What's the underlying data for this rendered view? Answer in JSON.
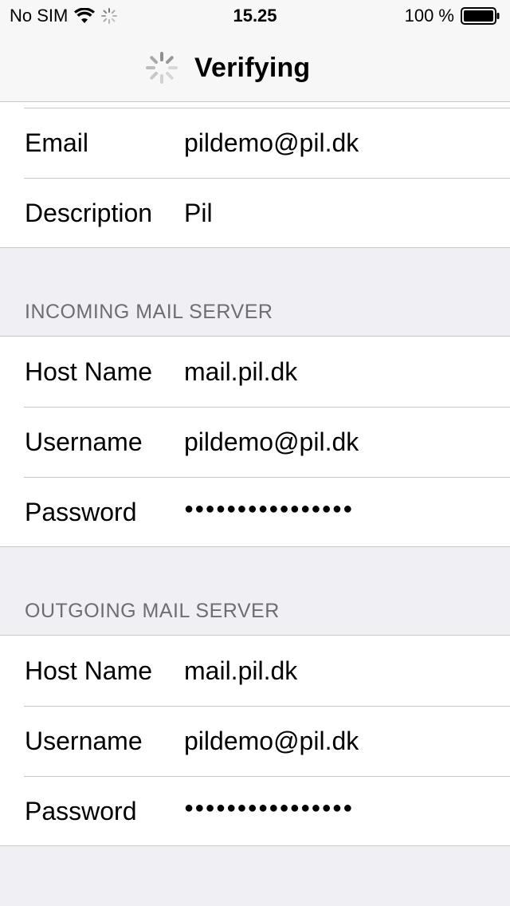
{
  "status_bar": {
    "carrier": "No SIM",
    "time": "15.25",
    "battery_percent": "100 %",
    "icons": [
      "wifi-icon",
      "activity-icon",
      "battery-icon"
    ]
  },
  "nav": {
    "title": "Verifying",
    "spinner_icon": "spinner-icon"
  },
  "account": {
    "rows": [
      {
        "label": "Email",
        "value": "pildemo@pil.dk"
      },
      {
        "label": "Description",
        "value": "Pil"
      }
    ]
  },
  "incoming": {
    "header": "INCOMING MAIL SERVER",
    "rows": [
      {
        "label": "Host Name",
        "value": "mail.pil.dk"
      },
      {
        "label": "Username",
        "value": "pildemo@pil.dk"
      },
      {
        "label": "Password",
        "value": "●●●●●●●●●●●●●●●●"
      }
    ]
  },
  "outgoing": {
    "header": "OUTGOING MAIL SERVER",
    "rows": [
      {
        "label": "Host Name",
        "value": "mail.pil.dk"
      },
      {
        "label": "Username",
        "value": "pildemo@pil.dk"
      },
      {
        "label": "Password",
        "value": "●●●●●●●●●●●●●●●●"
      }
    ]
  }
}
